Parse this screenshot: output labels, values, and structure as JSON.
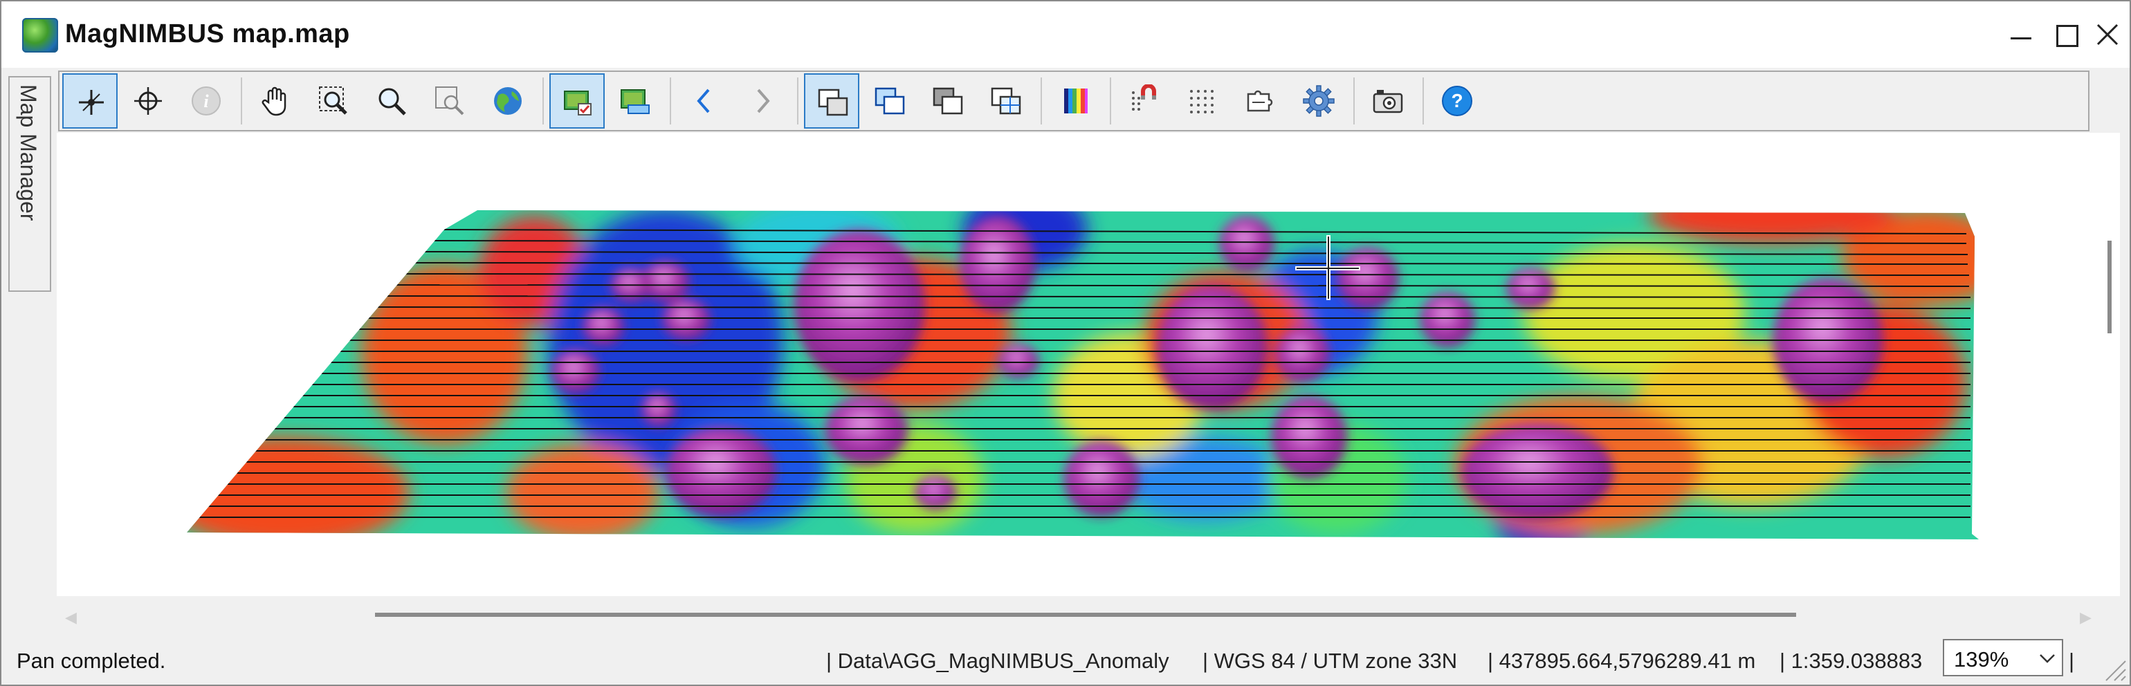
{
  "window": {
    "title": "MagNIMBUS map.map",
    "app_icon": "globe-map-icon",
    "controls": [
      "minimize-icon",
      "maximize-icon",
      "close-icon"
    ]
  },
  "toolbar": {
    "buttons": [
      {
        "name": "edit-vertex-tool",
        "icon": "crosshair-move-icon",
        "active": true
      },
      {
        "name": "select-point-tool",
        "icon": "crosshair-target-icon",
        "active": false
      },
      {
        "name": "info-tool",
        "icon": "info-icon",
        "active": false,
        "disabled": true
      },
      {
        "name": "pan-tool",
        "icon": "hand-icon",
        "active": false
      },
      {
        "name": "zoom-window-tool",
        "icon": "zoom-window-icon",
        "active": false
      },
      {
        "name": "zoom-tool",
        "icon": "magnifier-icon",
        "active": false
      },
      {
        "name": "zoom-extent-tool",
        "icon": "zoom-extent-icon",
        "active": false
      },
      {
        "name": "globe-tool",
        "icon": "globe-icon",
        "active": false
      },
      {
        "name": "layer-select-tool",
        "icon": "layer-check-icon",
        "active": true
      },
      {
        "name": "layer-edit-tool",
        "icon": "layer-edit-icon",
        "active": false
      },
      {
        "name": "back-button",
        "icon": "chevron-left-icon",
        "active": false
      },
      {
        "name": "forward-button",
        "icon": "chevron-right-icon",
        "active": false,
        "disabled": true
      },
      {
        "name": "view-frame-1",
        "icon": "frames-icon",
        "active": true
      },
      {
        "name": "view-frame-2",
        "icon": "frames-blue-icon",
        "active": false
      },
      {
        "name": "view-frame-3",
        "icon": "frames-dark-icon",
        "active": false
      },
      {
        "name": "view-frame-4",
        "icon": "frames-grid-icon",
        "active": false
      },
      {
        "name": "color-scale-tool",
        "icon": "color-bar-icon",
        "active": false
      },
      {
        "name": "magnet-grid-tool",
        "icon": "magnet-icon",
        "active": false
      },
      {
        "name": "dot-grid-tool",
        "icon": "dot-grid-icon",
        "active": false
      },
      {
        "name": "plugin-tool",
        "icon": "puzzle-icon",
        "active": false
      },
      {
        "name": "settings-tool",
        "icon": "gear-icon",
        "active": false
      },
      {
        "name": "snapshot-tool",
        "icon": "camera-icon",
        "active": false
      },
      {
        "name": "help-button",
        "icon": "help-icon",
        "active": false
      }
    ]
  },
  "side_panel": {
    "label": "Map Manager"
  },
  "status": {
    "message": "Pan completed.",
    "data_path": "| Data\\AGG_MagNIMBUS_Anomaly",
    "crs": "| WGS 84 / UTM zone 33N",
    "coordinates": "| 437895.664,5796289.41 m",
    "scale": "| 1:359.038883",
    "zoom": "139%",
    "trailing_sep": "|"
  },
  "colors": {
    "accent": "#2b7bc6",
    "active_bg": "#cce4f7",
    "chrome": "#f0f0f0",
    "help_blue": "#1e88e5"
  }
}
